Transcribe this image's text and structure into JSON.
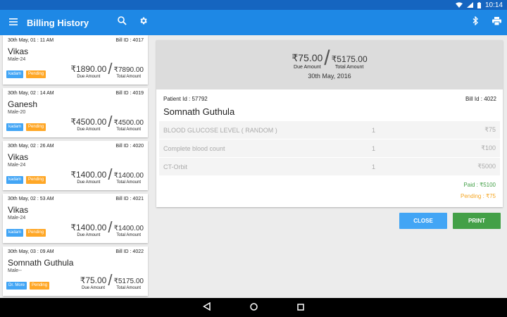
{
  "status_bar": {
    "time": "10:14"
  },
  "app_bar": {
    "title": "Billing History"
  },
  "bills": [
    {
      "datetime": "30th May, 01 : 11 AM",
      "bill_id": "Bill ID : 4017",
      "name": "Vikas",
      "sub": "Male-24",
      "doctor": "kadam",
      "status": "Pending",
      "due": "₹1890.00",
      "due_label": "Due Amount",
      "total": "₹7890.00",
      "total_label": "Total Amount"
    },
    {
      "datetime": "30th May, 02 : 14 AM",
      "bill_id": "Bill ID : 4019",
      "name": "Ganesh",
      "sub": "Male-20",
      "doctor": "kadam",
      "status": "Pending",
      "due": "₹4500.00",
      "due_label": "Due Amount",
      "total": "₹4500.00",
      "total_label": "Total Amount"
    },
    {
      "datetime": "30th May, 02 : 26 AM",
      "bill_id": "Bill ID : 4020",
      "name": "Vikas",
      "sub": "Male-24",
      "doctor": "kadam",
      "status": "Pending",
      "due": "₹1400.00",
      "due_label": "Due Amount",
      "total": "₹1400.00",
      "total_label": "Total Amount"
    },
    {
      "datetime": "30th May, 02 : 53 AM",
      "bill_id": "Bill ID : 4021",
      "name": "Vikas",
      "sub": "Male-24",
      "doctor": "kadam",
      "status": "Pending",
      "due": "₹1400.00",
      "due_label": "Due Amount",
      "total": "₹1400.00",
      "total_label": "Total Amount"
    },
    {
      "datetime": "30th May, 03 : 09 AM",
      "bill_id": "Bill ID : 4022",
      "name": "Somnath Guthula",
      "sub": "Male--",
      "doctor": "Dr. More",
      "status": "Pending",
      "due": "₹75.00",
      "due_label": "Due Amount",
      "total": "₹5175.00",
      "total_label": "Total Amount"
    }
  ],
  "detail": {
    "due": "₹75.00",
    "due_label": "Due Amount",
    "total": "₹5175.00",
    "total_label": "Total Amount",
    "date": "30th May, 2016",
    "patient_id": "Patient Id : 57792",
    "bill_id": "Bill Id : 4022",
    "patient_name": "Somnath Guthula",
    "items": [
      {
        "desc": "BLOOD GLUCOSE LEVEL ( RANDOM )",
        "qty": "1",
        "price": "₹75"
      },
      {
        "desc": "Complete blood count",
        "qty": "1",
        "price": "₹100"
      },
      {
        "desc": "CT-Orbit",
        "qty": "1",
        "price": "₹5000"
      }
    ],
    "paid": "Paid :  ₹5100",
    "pending": "Pending :  ₹75"
  },
  "buttons": {
    "close": "CLOSE",
    "print": "PRINT"
  },
  "colors": {
    "appbar": "#1e88e5",
    "statusbar": "#1565c0",
    "close": "#42a5f5",
    "print": "#43a047",
    "pending_tag": "#ffa726",
    "doctor_tag": "#42a5f5"
  },
  "icons": [
    "menu-icon",
    "search-icon",
    "gear-icon",
    "bluetooth-icon",
    "printer-icon",
    "back-icon",
    "home-icon",
    "recents-icon",
    "wifi-icon",
    "signal-icon",
    "battery-icon"
  ]
}
